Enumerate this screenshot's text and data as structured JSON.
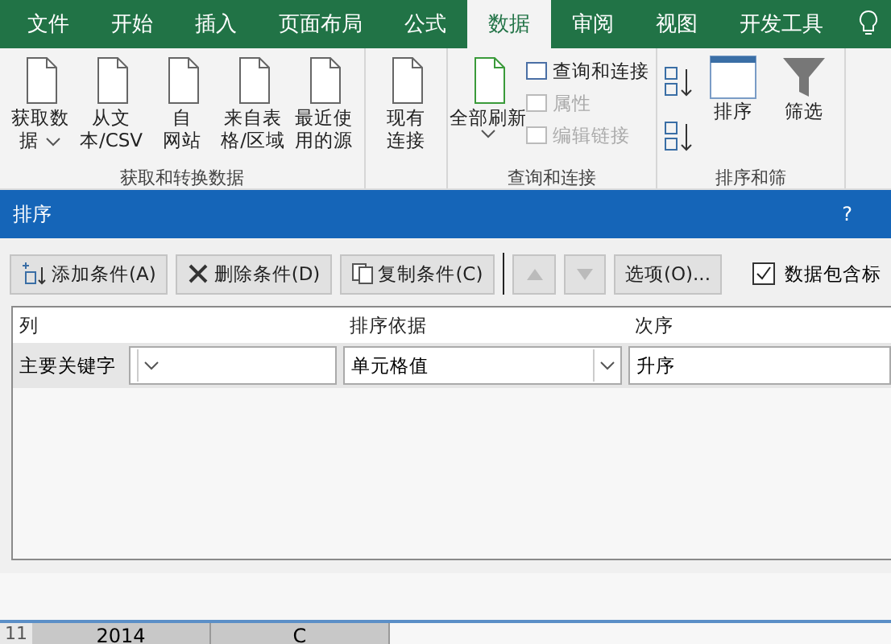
{
  "ribbon_tabs": [
    {
      "label": "文件",
      "selected": false
    },
    {
      "label": "开始",
      "selected": false
    },
    {
      "label": "插入",
      "selected": false
    },
    {
      "label": "页面布局",
      "selected": false
    },
    {
      "label": "公式",
      "selected": false
    },
    {
      "label": "数据",
      "selected": true
    },
    {
      "label": "审阅",
      "selected": false
    },
    {
      "label": "视图",
      "selected": false
    },
    {
      "label": "开发工具",
      "selected": false
    }
  ],
  "ribbon_groups": [
    {
      "label": "获取和转换数据",
      "buttons": [
        {
          "kind": "dropdown",
          "line1": "获取数",
          "line2": "据"
        },
        {
          "kind": "big",
          "line1": "从文",
          "line2": "本/CSV"
        },
        {
          "kind": "big",
          "line1": "自",
          "line2": "网站"
        },
        {
          "kind": "big",
          "line1": "来自表",
          "line2": "格/区域"
        },
        {
          "kind": "big",
          "line1": "最近使",
          "line2": "用的源"
        }
      ]
    },
    {
      "buttons": [
        {
          "kind": "big",
          "line1": "现有",
          "line2": "连接"
        }
      ]
    },
    {
      "label": "查询和连接",
      "buttons": [
        {
          "kind": "refresh",
          "line1": "全部刷新"
        },
        {
          "kind": "stack",
          "items": [
            {
              "label": "查询和连接",
              "disabled": false
            },
            {
              "label": "属性",
              "disabled": true
            },
            {
              "label": "编辑链接",
              "disabled": true
            }
          ]
        }
      ]
    },
    {
      "label": "排序和筛",
      "buttons": [
        {
          "kind": "sortsmall"
        },
        {
          "kind": "sort",
          "line1": "排序"
        },
        {
          "kind": "filter",
          "line1": "筛选"
        }
      ]
    }
  ],
  "dialog": {
    "title": "排序",
    "help": "?",
    "toolbar": [
      {
        "kind": "add",
        "label": "添加条件(A)"
      },
      {
        "kind": "delete",
        "label": "删除条件(D)"
      },
      {
        "kind": "copy",
        "label": "复制条件(C)"
      },
      {
        "kind": "up",
        "disabled": true
      },
      {
        "kind": "down",
        "disabled": true
      },
      {
        "kind": "plain",
        "label": "选项(O)..."
      }
    ],
    "header_checkbox": {
      "label": "数据包含标",
      "checked": true
    },
    "columns": [
      "列",
      "排序依据",
      "次序"
    ],
    "rows": [
      {
        "label": "主要关键字",
        "column": "",
        "sort_on": "单元格值",
        "order": "升序"
      }
    ]
  },
  "sheet_row": {
    "row_number": "11",
    "cells": [
      "2014",
      "C"
    ]
  }
}
